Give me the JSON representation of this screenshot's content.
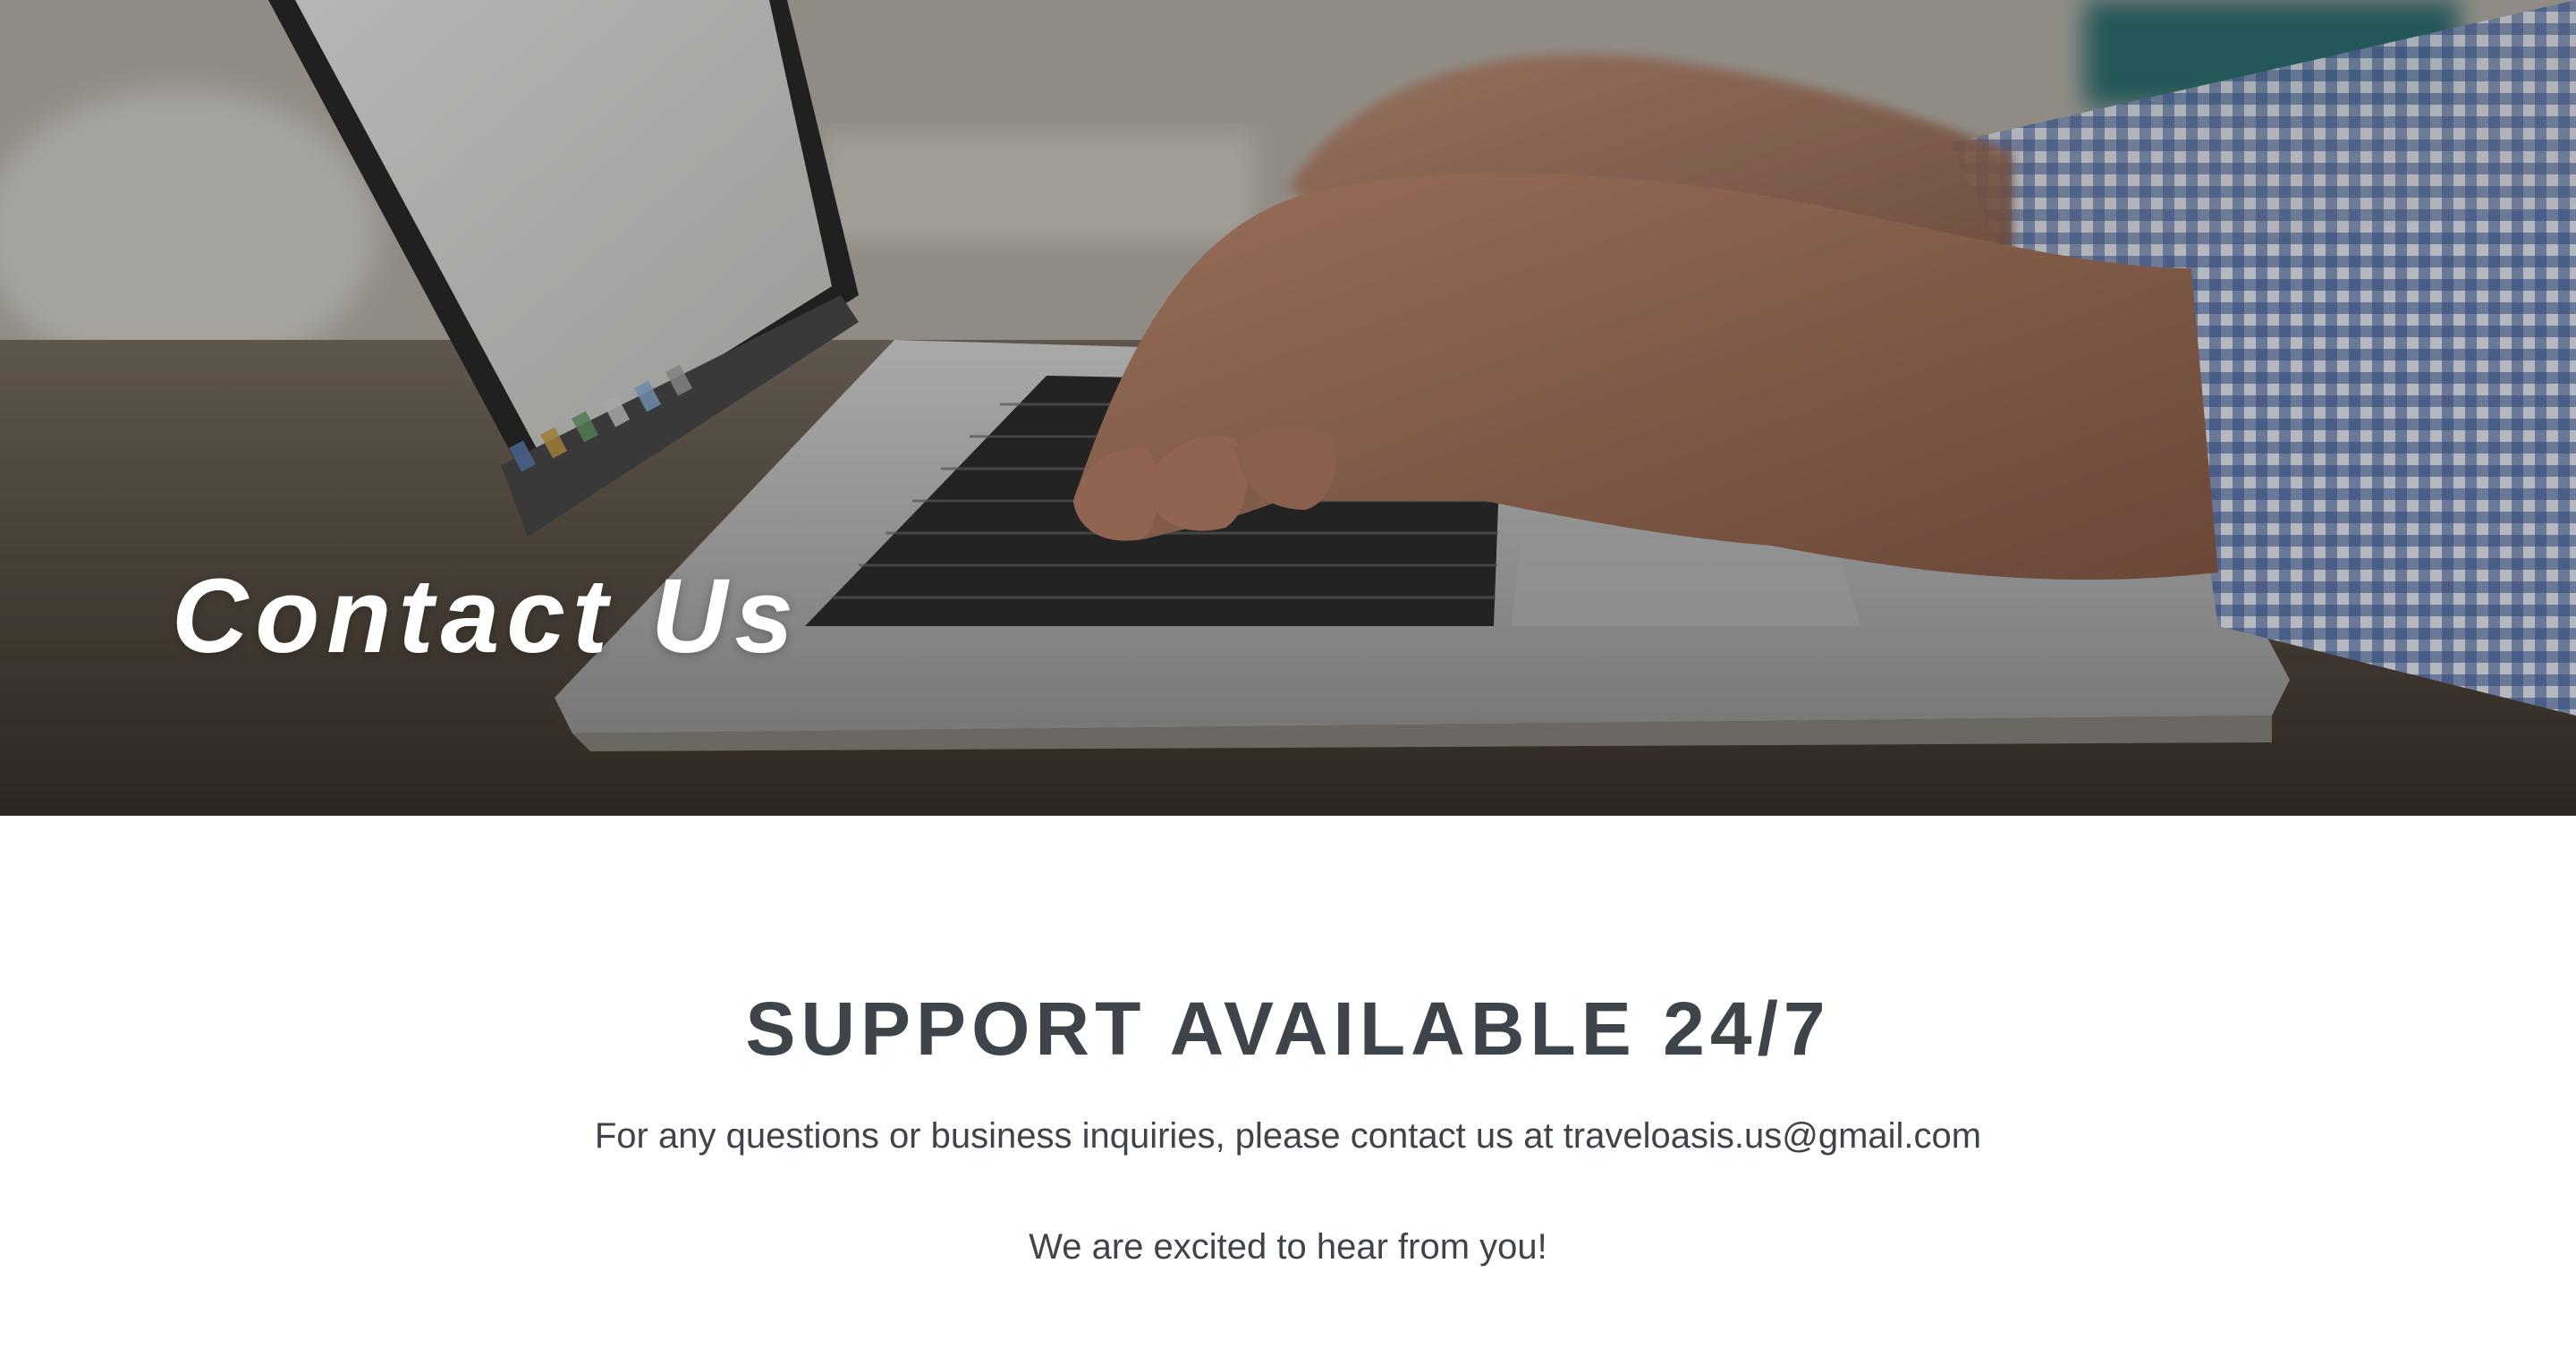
{
  "hero": {
    "title": "Contact Us"
  },
  "support": {
    "heading": "SUPPORT AVAILABLE 24/7",
    "inquiry_text": "For any questions or business inquiries, please contact us at ",
    "email": "traveloasis.us@gmail.com",
    "closing_text": "We are excited to hear from you!"
  },
  "colors": {
    "heading_text": "#3f444a",
    "hero_text": "#ffffff",
    "background": "#ffffff"
  }
}
